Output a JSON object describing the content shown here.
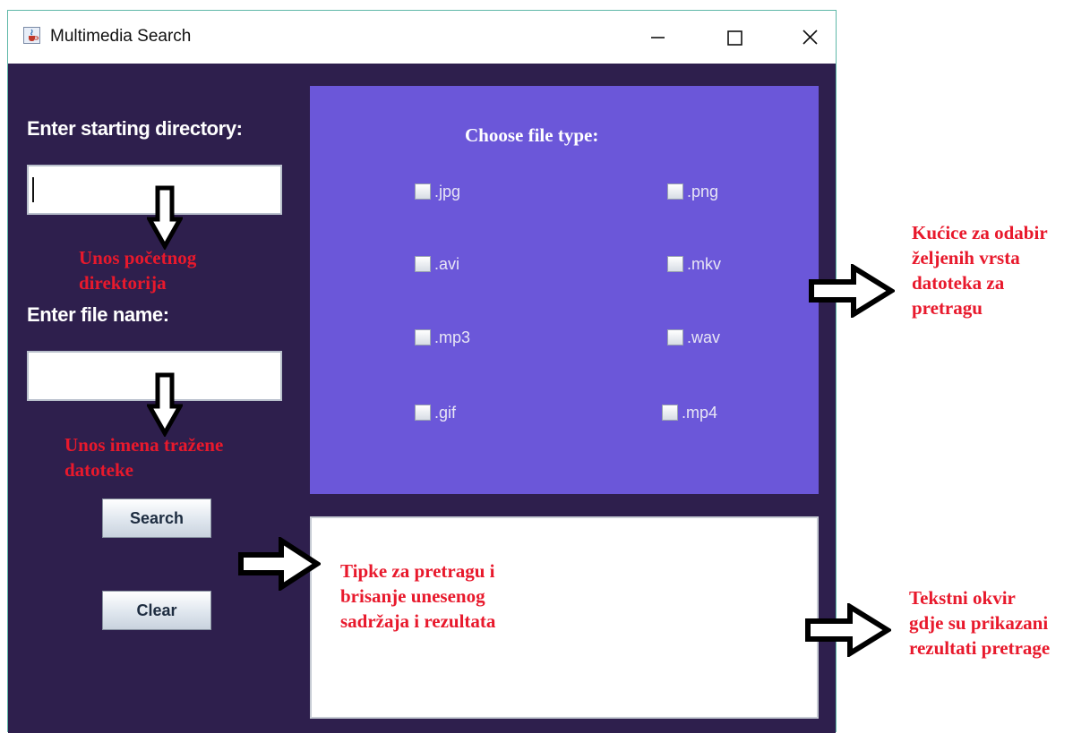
{
  "window": {
    "title": "Multimedia Search",
    "title_icon": "java-cup-icon"
  },
  "form": {
    "dir_label": "Enter starting directory:",
    "dir_value": "",
    "file_label": "Enter file name:",
    "file_value": "",
    "search_label": "Search",
    "clear_label": "Clear"
  },
  "filetypes": {
    "heading": "Choose file type:",
    "options": [
      {
        "label": ".jpg",
        "checked": false
      },
      {
        "label": ".png",
        "checked": false
      },
      {
        "label": ".avi",
        "checked": false
      },
      {
        "label": ".mkv",
        "checked": false
      },
      {
        "label": ".mp3",
        "checked": false
      },
      {
        "label": ".wav",
        "checked": false
      },
      {
        "label": ".gif",
        "checked": false
      },
      {
        "label": ".mp4",
        "checked": false
      }
    ]
  },
  "results": {
    "text": ""
  },
  "annotations": {
    "dir": [
      "Unos početnog",
      "direktorija"
    ],
    "file": [
      "Unos imena tražene",
      "datoteke"
    ],
    "types": [
      "Kućice za odabir",
      "željenih vrsta",
      "datoteka za",
      "pretragu"
    ],
    "buttons": [
      "Tipke za pretragu i",
      "brisanje unesenog",
      "sadržaja i rezultata"
    ],
    "results": [
      "Tekstni okvir",
      "gdje su prikazani",
      "rezultati pretrage"
    ]
  },
  "colors": {
    "background": "#2e1f4d",
    "panel": "#6b57d9",
    "annotation": "#e8192c"
  }
}
